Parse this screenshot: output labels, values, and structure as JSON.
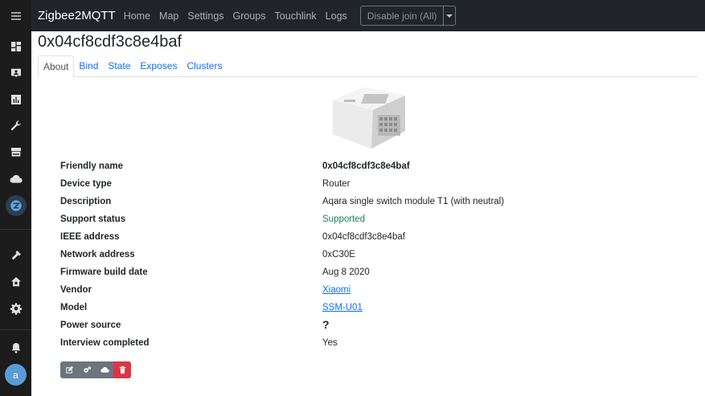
{
  "app": {
    "brand": "Zigbee2MQTT"
  },
  "navbar": {
    "links": [
      "Home",
      "Map",
      "Settings",
      "Groups",
      "Touchlink",
      "Logs"
    ],
    "join_button": "Disable join (All)"
  },
  "device": {
    "title": "0x04cf8cdf3c8e4baf",
    "tabs": [
      "About",
      "Bind",
      "State",
      "Exposes",
      "Clusters"
    ],
    "properties": [
      {
        "key": "Friendly name",
        "value": "0x04cf8cdf3c8e4baf"
      },
      {
        "key": "Device type",
        "value": "Router"
      },
      {
        "key": "Description",
        "value": "Aqara single switch module T1 (with neutral)"
      },
      {
        "key": "Support status",
        "value": "Supported"
      },
      {
        "key": "IEEE address",
        "value": "0x04cf8cdf3c8e4baf"
      },
      {
        "key": "Network address",
        "value": "0xC30E"
      },
      {
        "key": "Firmware build date",
        "value": "Aug 8 2020"
      },
      {
        "key": "Vendor",
        "value": "Xiaomi"
      },
      {
        "key": "Model",
        "value": "SSM-U01"
      },
      {
        "key": "Power source",
        "value": "?"
      },
      {
        "key": "Interview completed",
        "value": "Yes"
      }
    ]
  },
  "user": {
    "initial": "a"
  },
  "colors": {
    "sidebar": "#1c1c1c",
    "navbar": "#212529",
    "link": "#0d6efd",
    "supported": "#198754",
    "danger": "#dc3545",
    "secondary": "#6c757d"
  },
  "icons": {
    "sidebar": [
      "menu-icon",
      "dashboard-icon",
      "map-marker-icon",
      "chart-icon",
      "wrench-icon",
      "hacs-icon",
      "cloud-icon",
      "zigbee2mqtt-icon",
      "hammer-icon",
      "home-settings-icon",
      "gear-icon",
      "bell-icon"
    ],
    "actions": [
      "edit-icon",
      "cogs-icon",
      "cloud-icon",
      "trash-icon"
    ]
  }
}
